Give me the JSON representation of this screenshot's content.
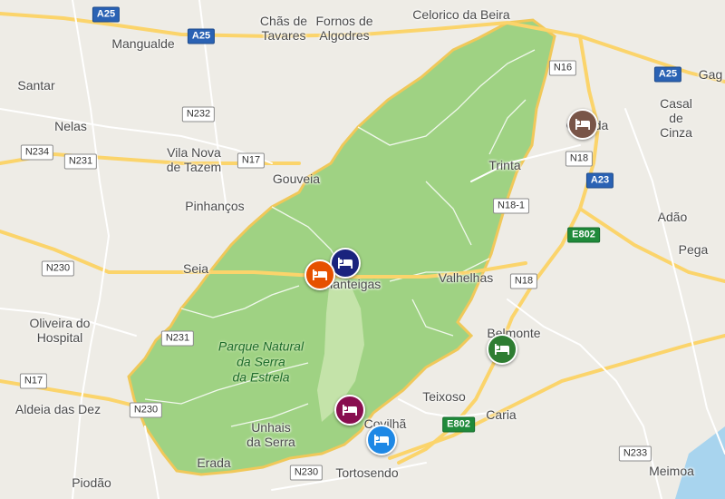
{
  "places": [
    {
      "id": "celorico-da-beira",
      "text": "Celorico da Beira"
    },
    {
      "id": "chas-de-tavares",
      "text": "Chãs de\nTavares"
    },
    {
      "id": "fornos-de-algodres",
      "text": "Fornos de\nAlgodres"
    },
    {
      "id": "mangualde",
      "text": "Mangualde"
    },
    {
      "id": "santar",
      "text": "Santar"
    },
    {
      "id": "nelas",
      "text": "Nelas"
    },
    {
      "id": "vila-nova-de-tazem",
      "text": "Vila Nova\nde Tazem"
    },
    {
      "id": "gouveia",
      "text": "Gouveia"
    },
    {
      "id": "pinhancos",
      "text": "Pinhanços"
    },
    {
      "id": "seia",
      "text": "Seia"
    },
    {
      "id": "manteigas",
      "text": "Manteigas"
    },
    {
      "id": "valhelhas",
      "text": "Valhelhas"
    },
    {
      "id": "trinta",
      "text": "Trinta"
    },
    {
      "id": "guarda",
      "text": "Guarda"
    },
    {
      "id": "casal-de-cinza",
      "text": "Casal de Cinza"
    },
    {
      "id": "gag",
      "text": "Gag"
    },
    {
      "id": "adao",
      "text": "Adão"
    },
    {
      "id": "pega",
      "text": "Pega"
    },
    {
      "id": "belmonte",
      "text": "Belmonte"
    },
    {
      "id": "oliveira-do-hospital",
      "text": "Oliveira do\nHospital"
    },
    {
      "id": "aldeia-das-dez",
      "text": "Aldeia das Dez"
    },
    {
      "id": "teixoso",
      "text": "Teixoso"
    },
    {
      "id": "caria",
      "text": "Caria"
    },
    {
      "id": "covilha",
      "text": "Covilhã"
    },
    {
      "id": "unhais-da-serra",
      "text": "Unhais\nda Serra"
    },
    {
      "id": "erada",
      "text": "Erada"
    },
    {
      "id": "tortosendo",
      "text": "Tortosendo"
    },
    {
      "id": "piodao",
      "text": "Piodão"
    },
    {
      "id": "meimoa",
      "text": "Meimoa"
    }
  ],
  "park_label": "Parque Natural\nda Serra\nda Estrela",
  "road_shields": [
    {
      "id": "a25-left",
      "text": "A25",
      "kind": "motor"
    },
    {
      "id": "a25-mid",
      "text": "A25",
      "kind": "motor"
    },
    {
      "id": "a25-right",
      "text": "A25",
      "kind": "motor"
    },
    {
      "id": "a23",
      "text": "A23",
      "kind": "motor"
    },
    {
      "id": "n16",
      "text": "N16",
      "kind": "nat"
    },
    {
      "id": "n232",
      "text": "N232",
      "kind": "nat"
    },
    {
      "id": "n234",
      "text": "N234",
      "kind": "nat"
    },
    {
      "id": "n231-a",
      "text": "N231",
      "kind": "nat"
    },
    {
      "id": "n17-a",
      "text": "N17",
      "kind": "nat"
    },
    {
      "id": "n18",
      "text": "N18",
      "kind": "nat"
    },
    {
      "id": "n18-1",
      "text": "N18-1",
      "kind": "nat"
    },
    {
      "id": "e802-a",
      "text": "E802",
      "kind": "euro"
    },
    {
      "id": "n230-a",
      "text": "N230",
      "kind": "nat"
    },
    {
      "id": "n18-b",
      "text": "N18",
      "kind": "nat"
    },
    {
      "id": "n231-b",
      "text": "N231",
      "kind": "nat"
    },
    {
      "id": "n17-b",
      "text": "N17",
      "kind": "nat"
    },
    {
      "id": "n230-b",
      "text": "N230",
      "kind": "nat"
    },
    {
      "id": "e802-b",
      "text": "E802",
      "kind": "euro"
    },
    {
      "id": "n233",
      "text": "N233",
      "kind": "nat"
    },
    {
      "id": "n230-c",
      "text": "N230",
      "kind": "nat"
    }
  ],
  "markers": [
    {
      "id": "guarda",
      "color": "#795548",
      "icon": "bed-icon"
    },
    {
      "id": "manteigas-navy",
      "color": "#1a237e",
      "icon": "bed-icon"
    },
    {
      "id": "manteigas-orange",
      "color": "#e65100",
      "icon": "bed-icon"
    },
    {
      "id": "belmonte",
      "color": "#2e7d32",
      "icon": "bed-icon"
    },
    {
      "id": "covilha-purple",
      "color": "#880e4f",
      "icon": "bed-icon"
    },
    {
      "id": "covilha-blue",
      "color": "#1e88e5",
      "icon": "bed-icon"
    }
  ],
  "colors": {
    "land": "#eeece6",
    "park": "#9fd283",
    "park_border": "#f0c85a",
    "major_road": "#fbd46b",
    "minor_road": "#ffffff",
    "water": "#a8d4ee"
  }
}
